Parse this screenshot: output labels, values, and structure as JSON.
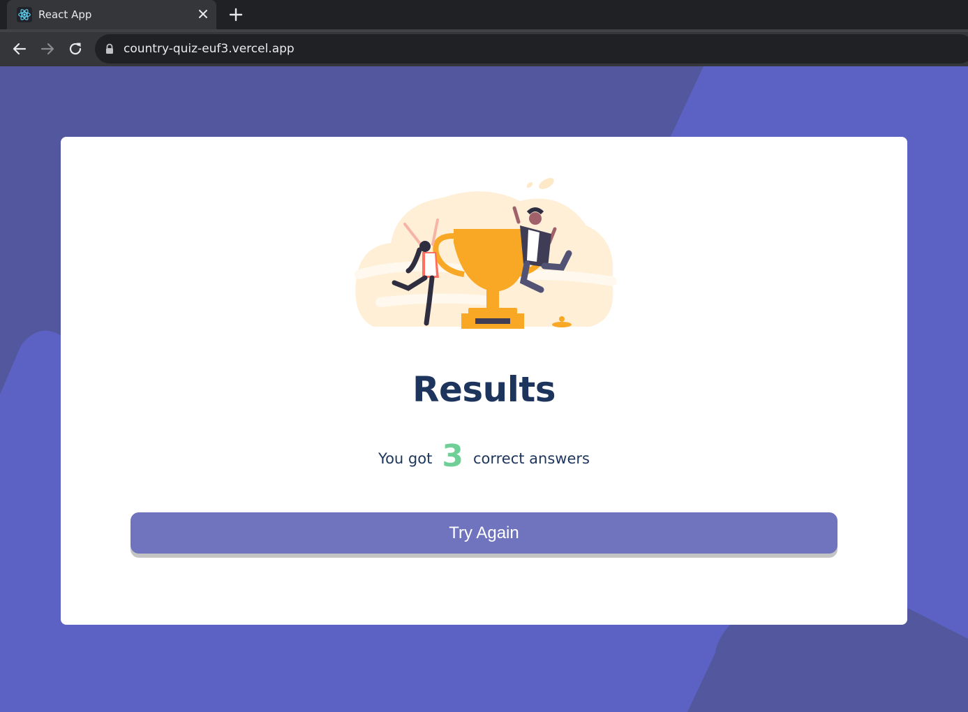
{
  "browser": {
    "tab_title": "React App",
    "url": "country-quiz-euf3.vercel.app"
  },
  "colors": {
    "background": "#5c62c4",
    "background_dark": "#53579e",
    "card": "#ffffff",
    "title": "#1d355d",
    "score": "#6fcf97",
    "button": "#7073bd"
  },
  "results": {
    "title": "Results",
    "prefix": "You got",
    "score": "3",
    "suffix": "correct answers",
    "button_label": "Try Again"
  },
  "icons": {
    "favicon": "react-logo-icon",
    "back": "arrow-left-icon",
    "forward": "arrow-right-icon",
    "reload": "reload-icon",
    "lock": "lock-icon",
    "close": "close-icon",
    "new_tab": "plus-icon"
  }
}
